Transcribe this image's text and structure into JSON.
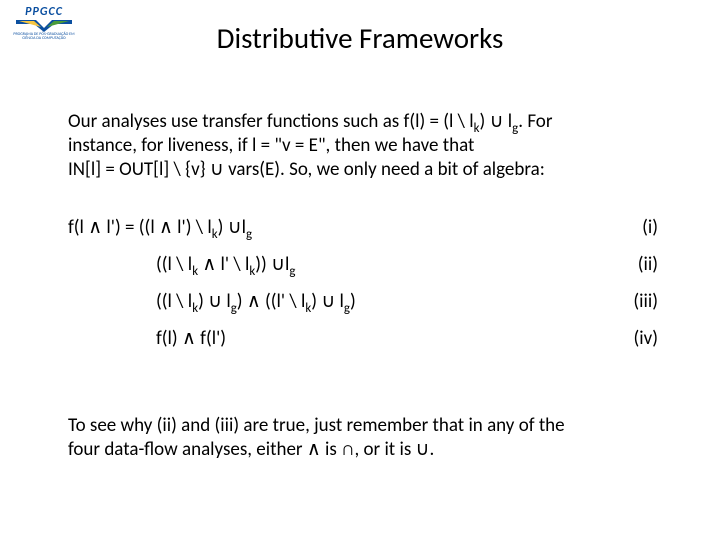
{
  "logo": {
    "acronym": "PPGCC",
    "subtitle": "PROGRAMA DE PÓS-GRADUAÇÃO EM CIÊNCIA DA COMPUTAÇÃO"
  },
  "title": "Distributive Frameworks",
  "intro": {
    "line1_a": "Our analyses use transfer functions such as f(l) = (l \\ l",
    "line1_sub1": "k",
    "line1_b": ") ∪ l",
    "line1_sub2": "g",
    "line1_c": ". For",
    "line2": "instance, for liveness, if l = \"v = E\", then we have that",
    "line3": "IN[l] = OUT[l] \\ {v} ∪ vars(E). So, we only need a bit of algebra:"
  },
  "equations": [
    {
      "lhs": "f(l ∧ l') = ",
      "body_parts": [
        "((l ∧ l') \\ l",
        "k",
        ") ∪l",
        "g"
      ],
      "num": "(i)"
    },
    {
      "lhs": "",
      "body_parts": [
        "((l \\ l",
        "k",
        " ∧ l' \\ l",
        "k",
        ")) ∪l",
        "g"
      ],
      "num": "(ii)"
    },
    {
      "lhs": "",
      "body_parts": [
        "((l \\ l",
        "k",
        ") ∪ l",
        "g",
        ") ∧ ((l' \\ l",
        "k",
        ") ∪ l",
        "g",
        ")"
      ],
      "num": "(iii)"
    },
    {
      "lhs": "",
      "body_parts": [
        "f(l) ∧ f(l')"
      ],
      "num": "(iv)"
    }
  ],
  "outro": {
    "line1": "To see why (ii) and (iii) are true, just remember that in any of the",
    "line2": "four data-flow analyses, either ∧ is ∩, or it is ∪."
  }
}
